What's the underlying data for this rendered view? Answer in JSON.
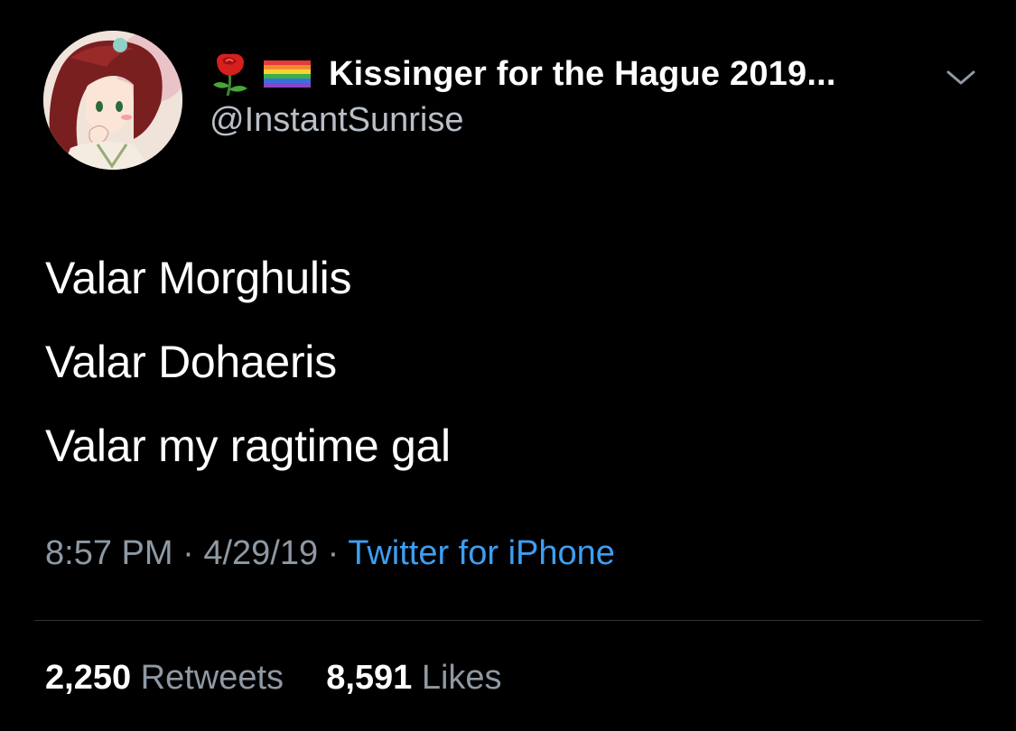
{
  "user": {
    "display_name": "Kissinger for the Hague 2019...",
    "handle": "@InstantSunrise",
    "name_icons": [
      "rose-icon",
      "rainbow-flag-icon"
    ]
  },
  "tweet": {
    "lines": [
      "Valar Morghulis",
      "Valar Dohaeris",
      "Valar my ragtime gal"
    ],
    "time": "8:57 PM",
    "separator": " · ",
    "date": "4/29/19",
    "source": "Twitter for iPhone"
  },
  "stats": {
    "retweets_count": "2,250",
    "retweets_label": "Retweets",
    "likes_count": "8,591",
    "likes_label": "Likes"
  },
  "colors": {
    "background": "#000000",
    "primary_text": "#ffffff",
    "secondary_text": "#8e99a4",
    "link": "#3d9ef2",
    "divider": "#2f3336"
  }
}
